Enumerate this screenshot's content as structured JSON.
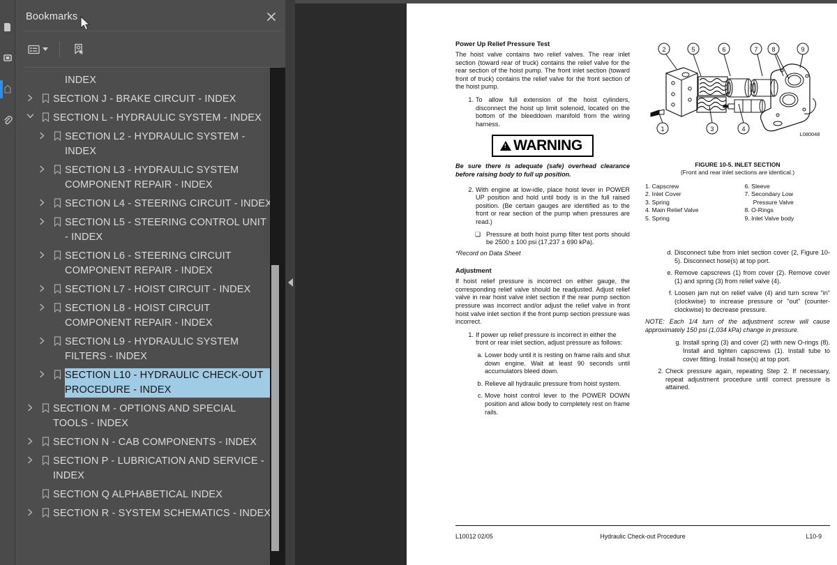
{
  "rail": {
    "icons": [
      {
        "name": "thumbnails-icon"
      },
      {
        "name": "page-view-icon"
      },
      {
        "name": "bookmarks-icon",
        "selected": true
      },
      {
        "name": "attachments-icon"
      }
    ]
  },
  "panel": {
    "title": "Bookmarks",
    "close_label": "✕",
    "tools": [
      {
        "name": "options-menu-icon",
        "label": "≣"
      },
      {
        "name": "new-bookmark-icon",
        "label": "⚑"
      }
    ]
  },
  "tree": {
    "items": [
      {
        "label": "INDEX",
        "level": 1,
        "twisty": "none",
        "bookmark": false,
        "selected": false
      },
      {
        "label": "SECTION J - BRAKE CIRCUIT - INDEX",
        "level": 0,
        "twisty": "collapsed",
        "bookmark": true,
        "selected": false
      },
      {
        "label": "SECTION L - HYDRAULIC SYSTEM - INDEX",
        "level": 0,
        "twisty": "expanded",
        "bookmark": true,
        "selected": false
      },
      {
        "label": "SECTION L2 - HYDRAULIC SYSTEM - INDEX",
        "level": 1,
        "twisty": "collapsed",
        "bookmark": true,
        "selected": false
      },
      {
        "label": "SECTION L3 - HYDRAULIC SYSTEM COMPONENT REPAIR - INDEX",
        "level": 1,
        "twisty": "collapsed",
        "bookmark": true,
        "selected": false
      },
      {
        "label": "SECTION L4 - STEERING CIRCUIT - INDEX",
        "level": 1,
        "twisty": "collapsed",
        "bookmark": true,
        "selected": false
      },
      {
        "label": "SECTION L5 - STEERING CONTROL UNIT - INDEX",
        "level": 1,
        "twisty": "collapsed",
        "bookmark": true,
        "selected": false
      },
      {
        "label": "SECTION L6 - STEERING CIRCUIT COMPONENT REPAIR - INDEX",
        "level": 1,
        "twisty": "collapsed",
        "bookmark": true,
        "selected": false
      },
      {
        "label": "SECTION L7 - HOIST CIRCUIT - INDEX",
        "level": 1,
        "twisty": "collapsed",
        "bookmark": true,
        "selected": false
      },
      {
        "label": "SECTION L8 - HOIST CIRCUIT COMPONENT REPAIR - INDEX",
        "level": 1,
        "twisty": "collapsed",
        "bookmark": true,
        "selected": false
      },
      {
        "label": "SECTION L9 - HYDRAULIC SYSTEM FILTERS - INDEX",
        "level": 1,
        "twisty": "collapsed",
        "bookmark": true,
        "selected": false
      },
      {
        "label": "SECTION L10 - HYDRAULIC CHECK-OUT PROCEDURE - INDEX",
        "level": 1,
        "twisty": "collapsed",
        "bookmark": true,
        "selected": true
      },
      {
        "label": "SECTION M - OPTIONS AND SPECIAL TOOLS - INDEX",
        "level": 0,
        "twisty": "collapsed",
        "bookmark": true,
        "selected": false
      },
      {
        "label": "SECTION N - CAB COMPONENTS - INDEX",
        "level": 0,
        "twisty": "collapsed",
        "bookmark": true,
        "selected": false
      },
      {
        "label": "SECTION P - LUBRICATION AND SERVICE - INDEX",
        "level": 0,
        "twisty": "collapsed",
        "bookmark": true,
        "selected": false
      },
      {
        "label": "SECTION Q ALPHABETICAL INDEX",
        "level": 0,
        "twisty": "none",
        "bookmark": true,
        "selected": false
      },
      {
        "label": "SECTION R - SYSTEM SCHEMATICS - INDEX",
        "level": 0,
        "twisty": "collapsed",
        "bookmark": true,
        "selected": false
      }
    ]
  },
  "document": {
    "left_column": {
      "heading": "Power Up Relief Pressure Test",
      "intro": "The hoist valve contains two relief valves. The rear inlet section (toward rear of truck) contains the relief valve for the rear section of the hoist pump. The front inlet section (toward front of truck) contains the relief valve for the front section of the hoist pump.",
      "step1_marker": "1.",
      "step1": "To allow full extension of the hoist cylinders, disconnect the hoist up limit solenoid, located on the bottom of the bleeddown manifold from the wiring harness.",
      "warning_word": "WARNING",
      "warning_text": "Be sure there is adequate (safe) overhead clearance before raising body to full up position.",
      "step2_marker": "2.",
      "step2": "With engine at low-idle, place hoist lever in POWER UP position and hold until body is in the full raised position. (Be certain gauges are identified as to the front or rear section of the pump when pressures are read.)",
      "checkbox_marker": "❑",
      "checkbox_text": "Pressure at both hoist pump filter test ports should be 2500 ± 100 psi (17,237 ± 690 kPa).",
      "record_note": "*Record on Data Sheet",
      "adjust_heading": "Adjustment",
      "adjust_intro": "If hoist relief pressure is incorrect on either gauge, the corresponding relief valve should be readjusted. Adjust relief valve in rear hoist valve inlet section if the rear pump section pressure was incorrect and/or adjust the relief valve in front hoist valve inlet section if the front pump section pressure was incorrect.",
      "a1_marker": "1.",
      "a1": "If power up relief pressure is incorrect in either the front or rear inlet section, adjust pressure as follows:",
      "sub_a_marker": "a.",
      "sub_a": "Lower body until it is resting on frame rails and shut down engine. Wait at least 90 seconds until accumulators bleed down.",
      "sub_b_marker": "b.",
      "sub_b": "Relieve all hydraulic pressure from hoist system.",
      "sub_c_marker": "c.",
      "sub_c": "Move hoist control lever to the POWER DOWN position and allow body to completely rest on frame rails."
    },
    "figure": {
      "callouts": [
        "1",
        "2",
        "3",
        "4",
        "5",
        "6",
        "7",
        "8",
        "9"
      ],
      "drawing_number": "L080048",
      "caption_title": "FIGURE 10-5. INLET SECTION",
      "caption_sub": "(Front and rear inlet sections are identical.)",
      "parts_left": "1. Capscrew\n2. Inlet Cover\n3. Spring\n4. Main Relief Valve\n5. Spring",
      "parts_right": "6. Sleeve\n7. Secondary Low\n     Pressure Valve\n8. O-Rings\n9. Inlet Valve body"
    },
    "right_column": {
      "sub_d_marker": "d.",
      "sub_d": "Disconnect tube from inlet section cover (2, Figure 10-5). Disconnect hose(s) at top port.",
      "sub_e_marker": "e.",
      "sub_e": "Remove capscrews (1) from cover (2). Remove cover (1) and spring (3) from relief valve (4).",
      "sub_f_marker": "f.",
      "sub_f": "Loosen jam nut on relief valve (4) and turn screw \"in\" (clockwise) to increase pressure or \"out\" (counter-clockwise) to decrease pressure.",
      "note": "NOTE: Each 1/4 turn of the adjustment screw will cause approximately 150 psi (1,034 kPa) change in pressure.",
      "sub_g_marker": "g.",
      "sub_g": "Install spring (3) and cover (2) with new O-rings (8). Install and tighten capscrews (1). Install tube to cover fitting. Install hose(s) at top port.",
      "a2_marker": "2.",
      "a2": "Check pressure again, repeating Step 2. If necessary, repeat adjustment procedure until correct pressure is attained."
    },
    "footer": {
      "left": "L10012   02/05",
      "center": "Hydraulic Check-out Procedure",
      "right": "L10-9"
    }
  },
  "colors": {
    "panel_bg": "#4d4d4d",
    "rail_bg": "#4a4a4a",
    "doc_bg": "#2b2b2b",
    "selection": "#9fcbe4",
    "accent": "#2a8ff0",
    "scroll_track": "#1a1a1a",
    "scroll_thumb": "#a6a6a6"
  }
}
